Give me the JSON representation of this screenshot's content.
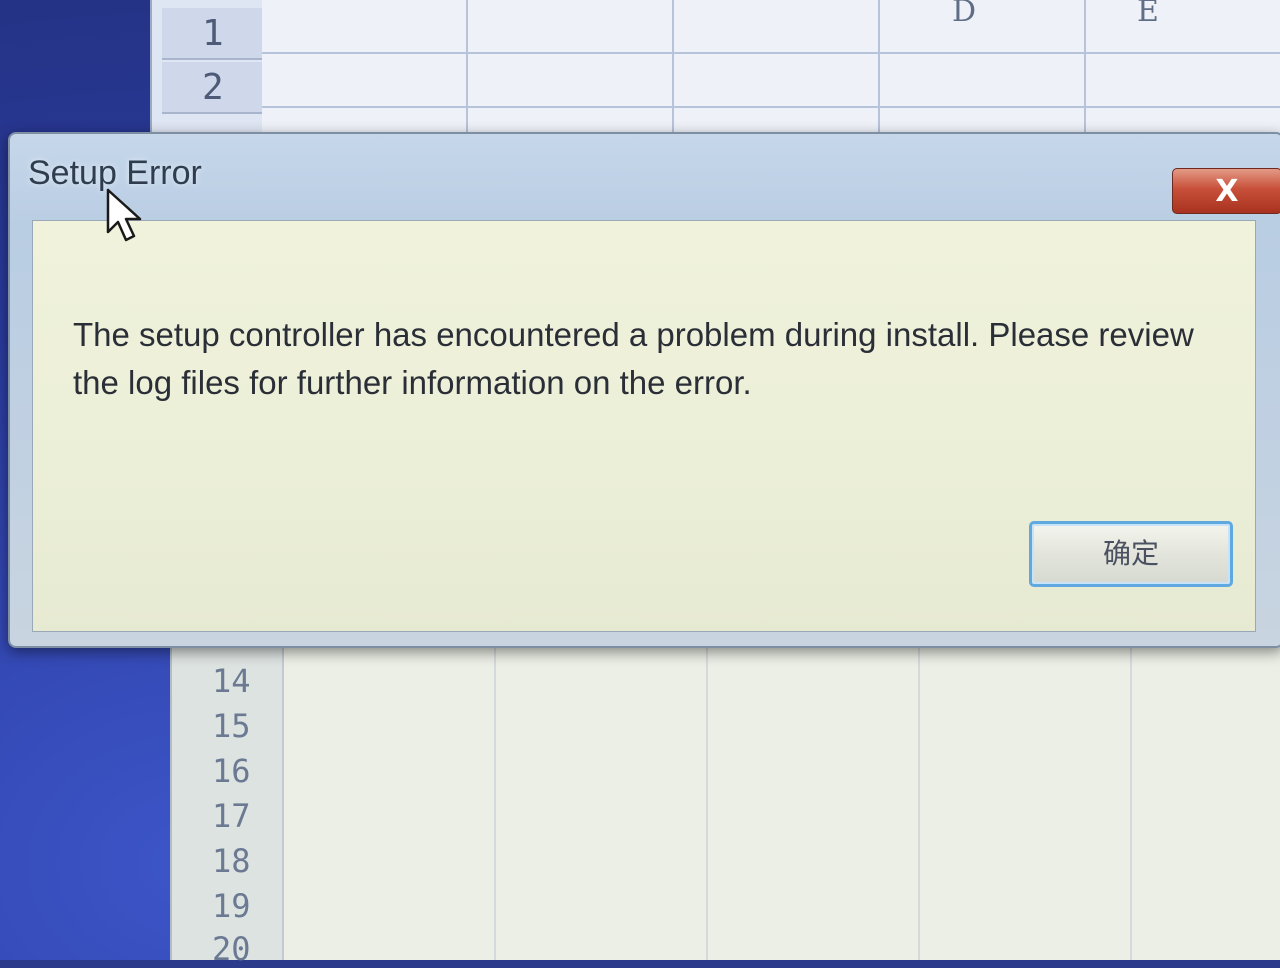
{
  "spreadsheet": {
    "column_headers": [
      "D",
      "E"
    ],
    "top_row_numbers": [
      "1",
      "2"
    ],
    "bottom_row_numbers": [
      "14",
      "15",
      "16",
      "17",
      "18",
      "19",
      "20"
    ]
  },
  "dialog": {
    "title": "Setup Error",
    "close_label": "X",
    "message": "The setup controller has encountered a problem during install.  Please review the log files for further information on the error.",
    "ok_label": "确定"
  },
  "icons": {
    "cursor": "arrow-pointer-icon",
    "close": "close-icon"
  },
  "colors": {
    "close_button": "#c8503a",
    "ok_button_border": "#5fa8e0",
    "desktop": "#2b3a8a"
  }
}
